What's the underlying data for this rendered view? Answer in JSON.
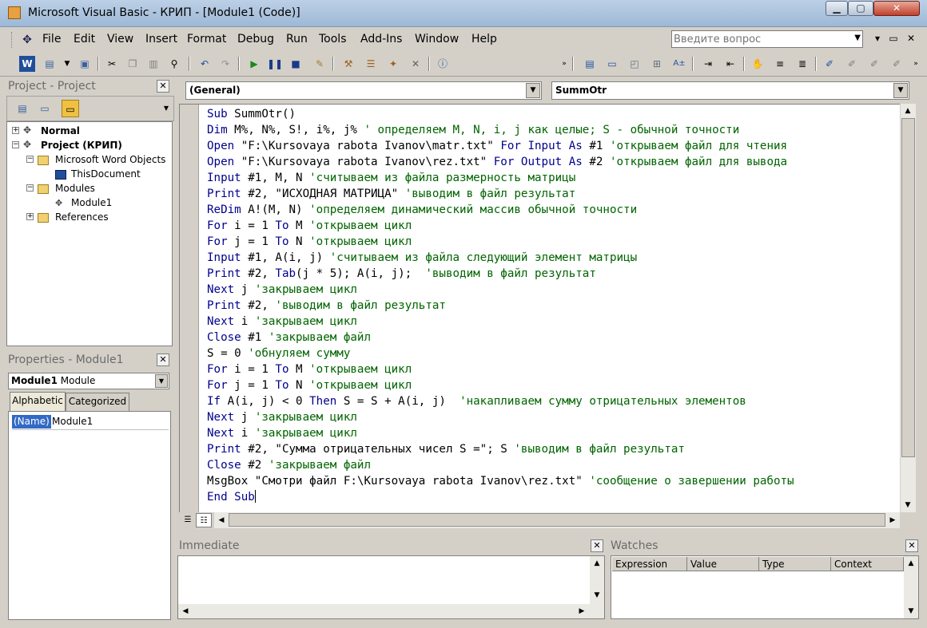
{
  "window": {
    "title": "Microsoft Visual Basic - КРИП - [Module1 (Code)]",
    "minimize": "▁",
    "maximize": "▢",
    "close": "✕"
  },
  "menu": {
    "items": [
      "File",
      "Edit",
      "View",
      "Insert",
      "Format",
      "Debug",
      "Run",
      "Tools",
      "Add-Ins",
      "Window",
      "Help"
    ],
    "ask_placeholder": "Введите вопрос",
    "mdi_min": "▾",
    "mdi_restore": "▭",
    "mdi_close": "✕"
  },
  "project_panel": {
    "title": "Project - Project",
    "tree": [
      {
        "label": "Normal",
        "bold": true
      },
      {
        "label": "Project (КРИП)",
        "bold": true
      },
      {
        "label": "Microsoft Word Objects",
        "bold": false
      },
      {
        "label": "ThisDocument",
        "bold": false
      },
      {
        "label": "Modules",
        "bold": false
      },
      {
        "label": "Module1",
        "bold": false
      },
      {
        "label": "References",
        "bold": false
      }
    ]
  },
  "properties_panel": {
    "title": "Properties - Module1",
    "object_name": "Module1",
    "object_type": "Module",
    "tabs": [
      "Alphabetic",
      "Categorized"
    ],
    "prop_name": "(Name)",
    "prop_value": "Module1"
  },
  "code_window": {
    "object_combo": "(General)",
    "proc_combo": "SummOtr",
    "lines": [
      [
        [
          "kw",
          "Sub "
        ],
        [
          "",
          "SummOtr()"
        ]
      ],
      [
        [
          "kw",
          "Dim "
        ],
        [
          "",
          "M%, N%, S!, i%, j% "
        ],
        [
          "cm",
          "' определяем M, N, i, j как целые; S - обычной точности"
        ]
      ],
      [
        [
          "kw",
          "Open "
        ],
        [
          "",
          "\"F:\\Kursovaya rabota Ivanov\\matr.txt\" "
        ],
        [
          "kw",
          "For Input As "
        ],
        [
          "",
          "#1 "
        ],
        [
          "cm",
          "'открываем файл для чтения"
        ]
      ],
      [
        [
          "kw",
          "Open "
        ],
        [
          "",
          "\"F:\\Kursovaya rabota Ivanov\\rez.txt\" "
        ],
        [
          "kw",
          "For Output As "
        ],
        [
          "",
          "#2 "
        ],
        [
          "cm",
          "'открываем файл для вывода"
        ]
      ],
      [
        [
          "kw",
          "Input "
        ],
        [
          "",
          "#1, M, N "
        ],
        [
          "cm",
          "'считываем из файла размерность матрицы"
        ]
      ],
      [
        [
          "kw",
          "Print "
        ],
        [
          "",
          "#2, \"ИСХОДНАЯ МАТРИЦА\" "
        ],
        [
          "cm",
          "'выводим в файл результат"
        ]
      ],
      [
        [
          "kw",
          "ReDim "
        ],
        [
          "",
          "A!(M, N) "
        ],
        [
          "cm",
          "'определяем динамический массив обычной точности"
        ]
      ],
      [
        [
          "kw",
          "For "
        ],
        [
          "",
          "i = 1 "
        ],
        [
          "kw",
          "To "
        ],
        [
          "",
          "M "
        ],
        [
          "cm",
          "'открываем цикл"
        ]
      ],
      [
        [
          "kw",
          "For "
        ],
        [
          "",
          "j = 1 "
        ],
        [
          "kw",
          "To "
        ],
        [
          "",
          "N "
        ],
        [
          "cm",
          "'открываем цикл"
        ]
      ],
      [
        [
          "kw",
          "Input "
        ],
        [
          "",
          "#1, A(i, j) "
        ],
        [
          "cm",
          "'считываем из файла следующий элемент матрицы"
        ]
      ],
      [
        [
          "kw",
          "Print "
        ],
        [
          "",
          "#2, "
        ],
        [
          "kw",
          "Tab"
        ],
        [
          "",
          "(j * 5); A(i, j);  "
        ],
        [
          "cm",
          "'выводим в файл результат"
        ]
      ],
      [
        [
          "kw",
          "Next "
        ],
        [
          "",
          "j "
        ],
        [
          "cm",
          "'закрываем цикл"
        ]
      ],
      [
        [
          "kw",
          "Print "
        ],
        [
          "",
          "#2, "
        ],
        [
          "cm",
          "'выводим в файл результат"
        ]
      ],
      [
        [
          "kw",
          "Next "
        ],
        [
          "",
          "i "
        ],
        [
          "cm",
          "'закрываем цикл"
        ]
      ],
      [
        [
          "kw",
          "Close "
        ],
        [
          "",
          "#1 "
        ],
        [
          "cm",
          "'закрываем файл"
        ]
      ],
      [
        [
          "",
          "S = 0 "
        ],
        [
          "cm",
          "'обнуляем сумму"
        ]
      ],
      [
        [
          "kw",
          "For "
        ],
        [
          "",
          "i = 1 "
        ],
        [
          "kw",
          "To "
        ],
        [
          "",
          "M "
        ],
        [
          "cm",
          "'открываем цикл"
        ]
      ],
      [
        [
          "kw",
          "For "
        ],
        [
          "",
          "j = 1 "
        ],
        [
          "kw",
          "To "
        ],
        [
          "",
          "N "
        ],
        [
          "cm",
          "'открываем цикл"
        ]
      ],
      [
        [
          "kw",
          "If "
        ],
        [
          "",
          "A(i, j) < 0 "
        ],
        [
          "kw",
          "Then "
        ],
        [
          "",
          "S = S + A(i, j)  "
        ],
        [
          "cm",
          "'накапливаем сумму отрицательных элементов"
        ]
      ],
      [
        [
          "kw",
          "Next "
        ],
        [
          "",
          "j "
        ],
        [
          "cm",
          "'закрываем цикл"
        ]
      ],
      [
        [
          "kw",
          "Next "
        ],
        [
          "",
          "i "
        ],
        [
          "cm",
          "'закрываем цикл"
        ]
      ],
      [
        [
          "kw",
          "Print "
        ],
        [
          "",
          "#2, \"Сумма отрицательных чисел S =\"; S "
        ],
        [
          "cm",
          "'выводим в файл результат"
        ]
      ],
      [
        [
          "kw",
          "Close "
        ],
        [
          "",
          "#2 "
        ],
        [
          "cm",
          "'закрываем файл"
        ]
      ],
      [
        [
          "",
          "MsgBox \"Смотри файл F:\\Kursovaya rabota Ivanov\\rez.txt\" "
        ],
        [
          "cm",
          "'сообщение о завершении работы"
        ]
      ],
      [
        [
          "kw",
          "End Sub"
        ]
      ]
    ]
  },
  "immediate": {
    "title": "Immediate"
  },
  "watches": {
    "title": "Watches",
    "columns": [
      "Expression",
      "Value",
      "Type",
      "Context"
    ]
  },
  "colors": {
    "keyword": "#00008b",
    "comment": "#006400",
    "selection": "#316ac5"
  }
}
